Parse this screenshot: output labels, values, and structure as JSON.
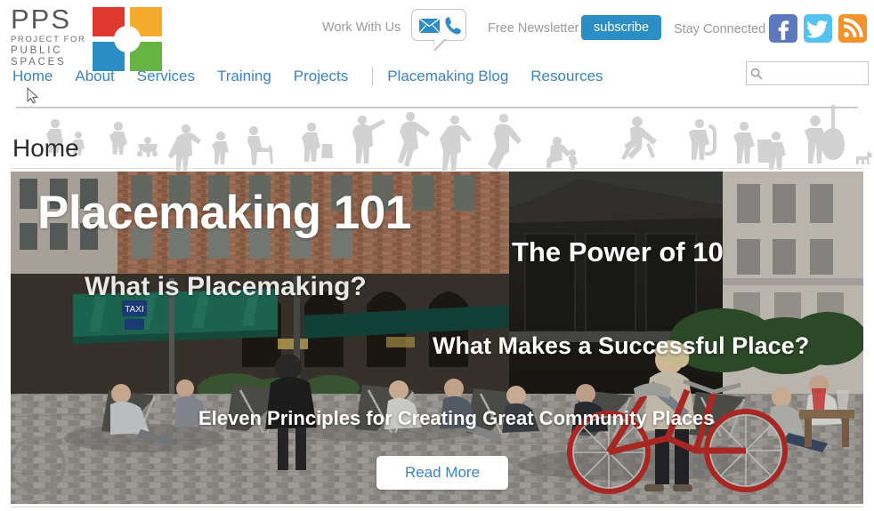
{
  "site": {
    "logo": {
      "acronym": "PPS",
      "line1": "PROJECT FOR",
      "line2": "PUBLIC",
      "line3": "SPACES",
      "colors": {
        "top_left": "#e03a30",
        "top_right": "#f5ab2b",
        "bottom_left": "#2b8fc6",
        "bottom_right": "#66b544"
      }
    }
  },
  "utility_bar": {
    "work_with_us_label": "Work With Us",
    "contact_icons": [
      "envelope-icon",
      "phone-icon"
    ],
    "free_newsletter_label": "Free Newsletter",
    "subscribe_label": "subscribe",
    "stay_connected_label": "Stay Connected",
    "social": [
      {
        "name": "facebook",
        "glyph": "f",
        "color": "#5d78bd"
      },
      {
        "name": "twitter",
        "glyph": "bird",
        "color": "#55c3f0"
      },
      {
        "name": "rss",
        "glyph": "rss",
        "color": "#f0932b"
      }
    ]
  },
  "nav": {
    "items": [
      {
        "label": "Home"
      },
      {
        "label": "About"
      },
      {
        "label": "Services"
      },
      {
        "label": "Training"
      },
      {
        "label": "Projects"
      },
      {
        "label": "Placemaking Blog"
      },
      {
        "label": "Resources"
      }
    ],
    "divider_after_index": 4,
    "link_color": "#3a84c0"
  },
  "search": {
    "placeholder": "",
    "value": "",
    "icon": "magnifier-icon"
  },
  "page": {
    "title": "Home"
  },
  "hero": {
    "headline": "Placemaking 101",
    "links": [
      {
        "id": "power-of-10",
        "label": "The Power of 10"
      },
      {
        "id": "what-is-placemaking",
        "label": "What is Placemaking?"
      },
      {
        "id": "successful-place",
        "label": "What Makes a Successful Place?"
      },
      {
        "id": "eleven-principles",
        "label": "Eleven Principles for Creating Great Community Places"
      }
    ],
    "cta_label": "Read More",
    "cta_text_color": "#3a84c0",
    "scene_description": "European city plaza with cafe awning, deck chairs, people relaxing and a woman with a red bicycle on cobblestones"
  },
  "band": {
    "description": "grey silhouettes of people walking, sitting, cycling along a horizontal line"
  }
}
